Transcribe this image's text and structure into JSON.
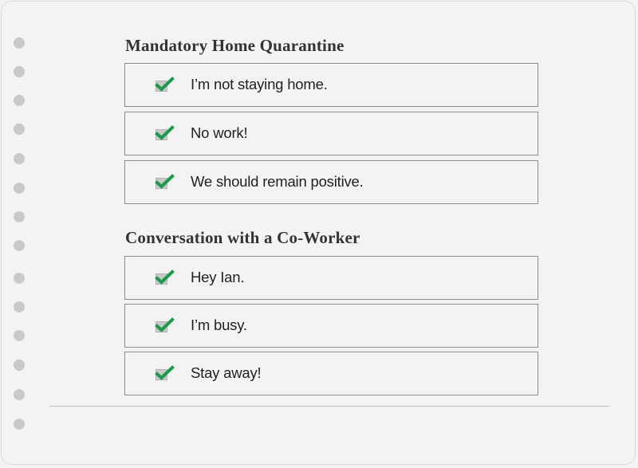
{
  "sections": [
    {
      "title": "Mandatory Home Quarantine",
      "items": [
        {
          "label": "I’m not staying home.",
          "checked": true
        },
        {
          "label": "No work!",
          "checked": true
        },
        {
          "label": "We should remain positive.",
          "checked": true
        }
      ]
    },
    {
      "title": "Conversation with a Co-Worker",
      "items": [
        {
          "label": "Hey Ian.",
          "checked": true
        },
        {
          "label": "I’m busy.",
          "checked": true
        },
        {
          "label": "Stay away!",
          "checked": true
        }
      ]
    }
  ],
  "colors": {
    "check": "#1a9a4a",
    "box": "#c9c9c9",
    "border": "#8a8a8a",
    "background": "#f3f3f3"
  }
}
